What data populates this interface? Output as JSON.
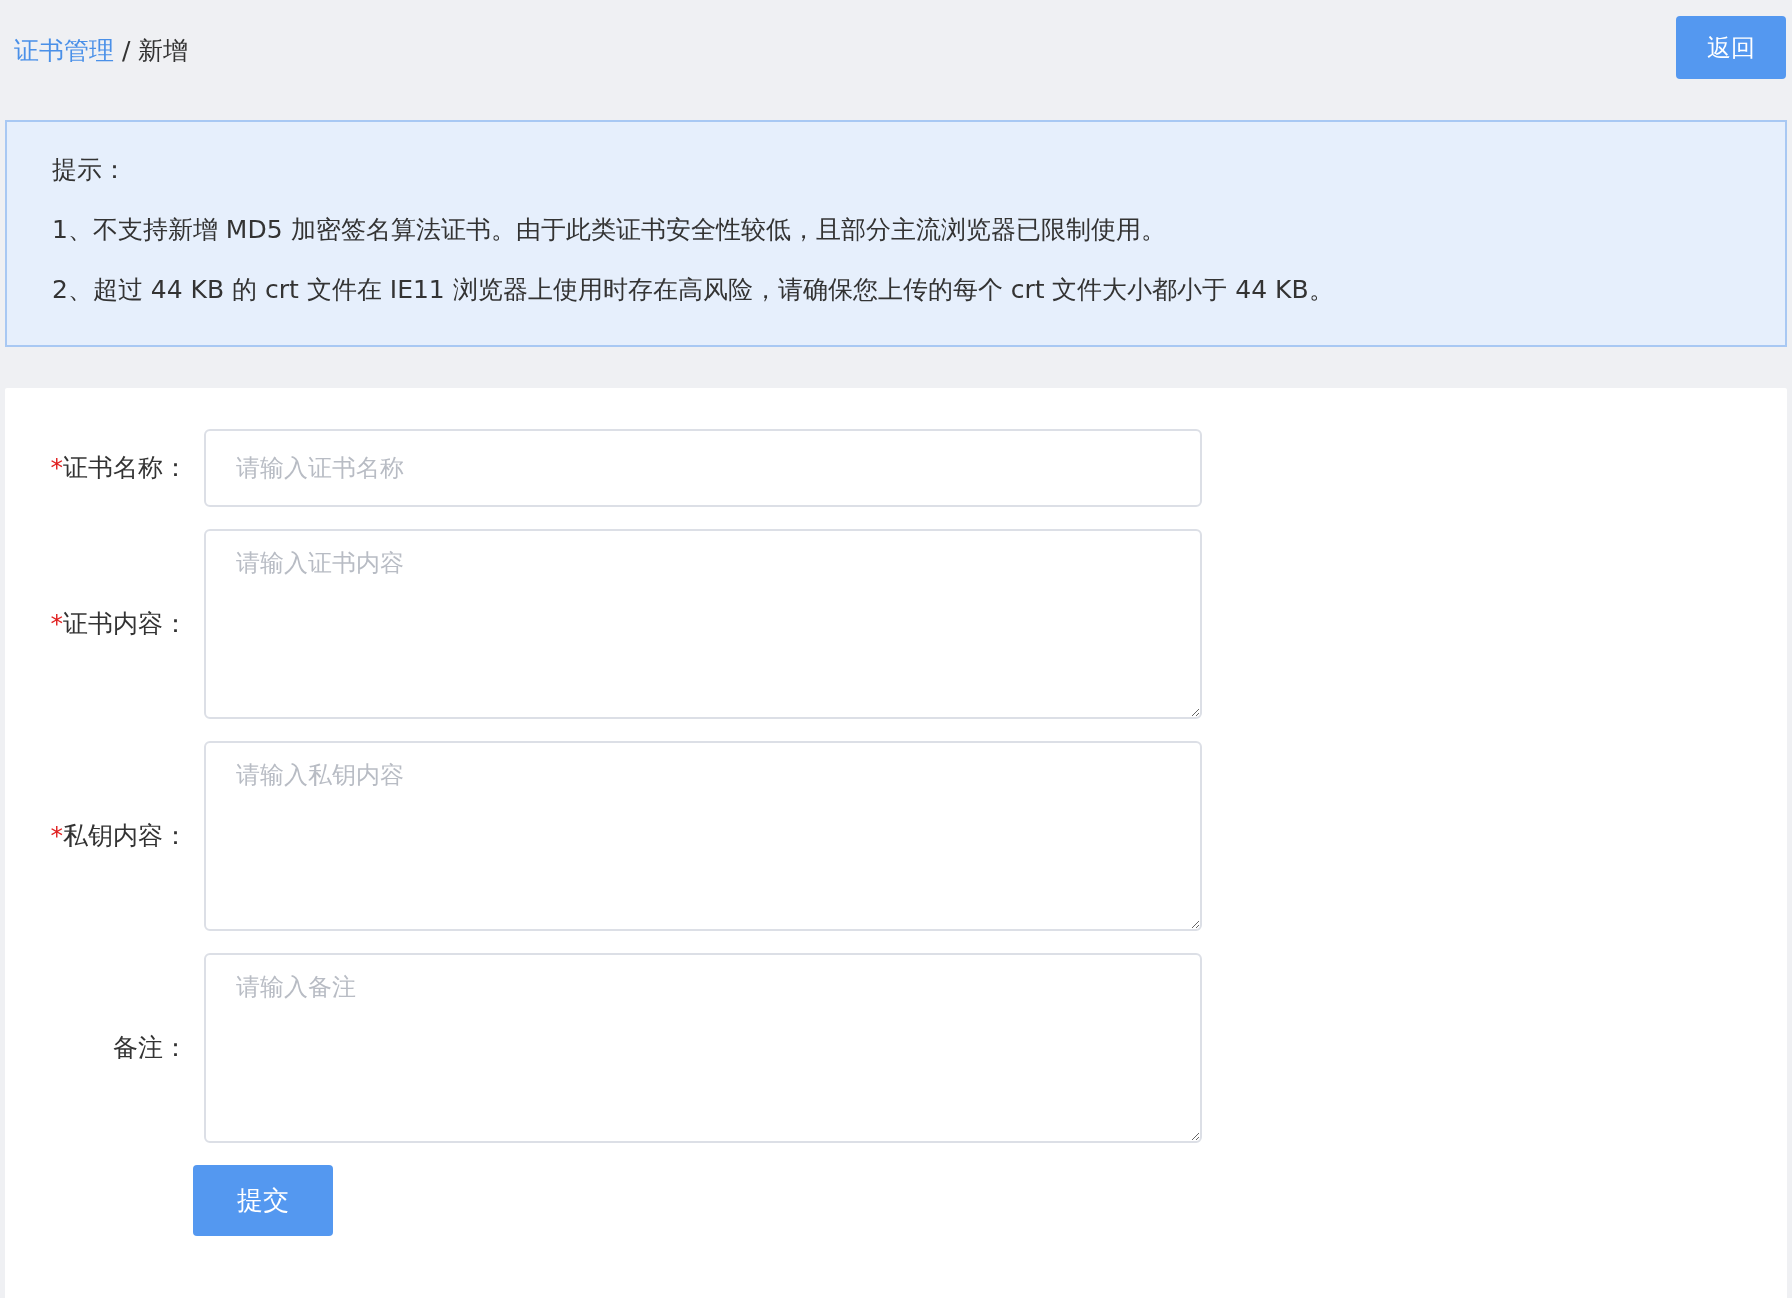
{
  "breadcrumb": [
    {
      "label": "证书管理",
      "link": true
    },
    {
      "label": "/",
      "link": false
    },
    {
      "label": "新增",
      "link": false
    }
  ],
  "back_button": "返回",
  "notice": {
    "title": "提示：",
    "lines": [
      "1、不支持新增 MD5 加密签名算法证书。由于此类证书安全性较低，且部分主流浏览器已限制使用。",
      "2、超过 44 KB 的 crt 文件在 IE11 浏览器上使用时存在高风险，请确保您上传的每个 crt 文件大小都小于 44 KB。"
    ]
  },
  "form": {
    "fields": [
      {
        "kind": "input",
        "marker": "*",
        "label": "证书名称：",
        "placeholder": "请输入证书名称"
      },
      {
        "kind": "textarea",
        "marker": "*",
        "label": "证书内容：",
        "placeholder": "请输入证书内容"
      },
      {
        "kind": "textarea",
        "marker": "*",
        "label": "私钥内容：",
        "placeholder": "请输入私钥内容"
      },
      {
        "kind": "textarea",
        "label": "备注：",
        "placeholder": "请输入备注"
      }
    ],
    "submit": "提交"
  }
}
